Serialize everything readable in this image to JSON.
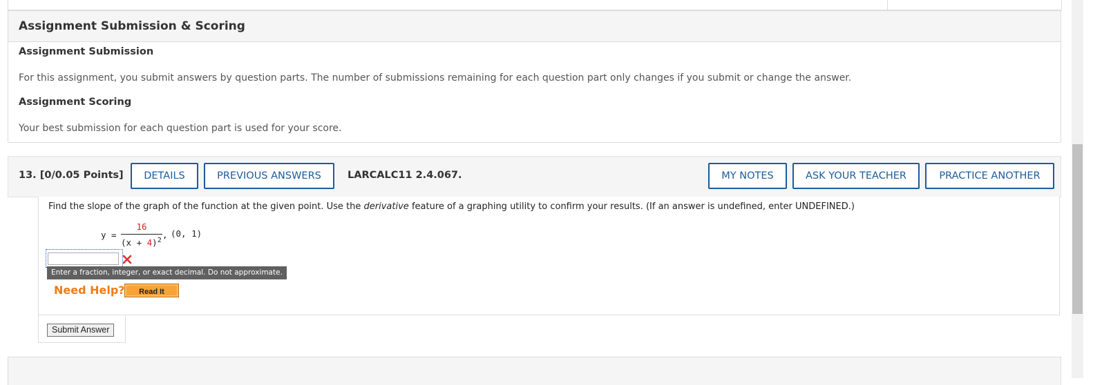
{
  "assignment": {
    "header": "Assignment Submission & Scoring",
    "submission_title": "Assignment Submission",
    "submission_text": "For this assignment, you submit answers by question parts. The number of submissions remaining for each question part only changes if you submit or change the answer.",
    "scoring_title": "Assignment Scoring",
    "scoring_text": "Your best submission for each question part is used for your score."
  },
  "question": {
    "number_points": "13.  [0/0.05 Points]",
    "code": "LARCALC11 2.4.067.",
    "buttons": {
      "details": "DETAILS",
      "previous_answers": "PREVIOUS ANSWERS",
      "my_notes": "MY NOTES",
      "ask_teacher": "ASK YOUR TEACHER",
      "practice_another": "PRACTICE ANOTHER"
    },
    "prompt_before": "Find the slope of the graph of the function at the given point. Use the ",
    "prompt_emph": "derivative",
    "prompt_after": " feature of a graphing utility to confirm your results. (If an answer is undefined, enter UNDEFINED.)",
    "formula": {
      "lhs": "y =",
      "numerator": "16",
      "denom_open": "(x + ",
      "denom_num": "4",
      "denom_close": ")",
      "exponent": "2",
      "comma": ",",
      "point": "(0, 1)"
    },
    "answer_value": "",
    "tooltip": "Enter a fraction, integer, or exact decimal. Do not approximate.",
    "need_help": "Need Help?",
    "read_it": "Read It",
    "submit": "Submit Answer"
  },
  "colors": {
    "button_blue": "#1b5b9a",
    "need_help_orange": "#f07c14",
    "error_red": "#e03030",
    "given_value_red": "#d42020"
  },
  "icons": {
    "incorrect": "x-mark-icon"
  }
}
